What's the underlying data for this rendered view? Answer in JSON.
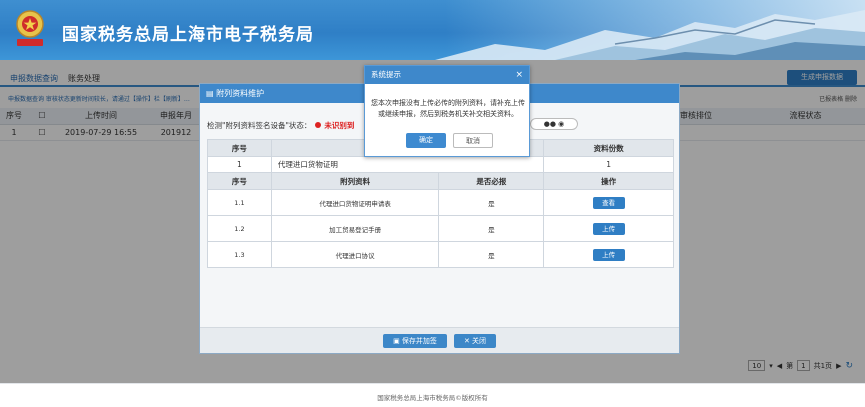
{
  "header": {
    "title": "国家税务总局上海市电子税务局",
    "emblem_text": "中国税务"
  },
  "tabs": [
    {
      "label": "申报数据查询",
      "active": true
    },
    {
      "label": "账务处理",
      "active": false
    }
  ],
  "toolbar": {
    "generate_label": "生成申报数据",
    "notice": "申报数据查询 审核状态更新时间较长，请通过【操作】栏【刷新】…",
    "right_links": "已报表格   删除"
  },
  "main_table": {
    "headers": [
      "序号",
      "",
      "上传时间",
      "申报年月",
      "",
      "",
      "",
      "",
      "",
      "审核排位",
      "流程状态"
    ],
    "rows": [
      [
        "1",
        "",
        "2019-07-29 16:55",
        "201912",
        "",
        "",
        "",
        "",
        "",
        "",
        ""
      ]
    ]
  },
  "pager": {
    "page_size": "10",
    "prefix": "第",
    "page": "1",
    "suffix": "共1页"
  },
  "footer": "国家税务总局上海市税务局©版权所有",
  "dialog": {
    "title": "附列资料维护",
    "detect_label": "检测\"附列资料签名设备\"状态：",
    "detect_status": "未识别到",
    "pwd_icon": "●●",
    "cert_table": {
      "headers": [
        "序号",
        "",
        "资料份数"
      ],
      "rows": [
        [
          "1",
          "代理进口货物证明",
          "1"
        ]
      ]
    },
    "att_table": {
      "headers": [
        "序号",
        "附列资料",
        "是否必报",
        "操作"
      ],
      "rows": [
        [
          "1.1",
          "代理进口货物证明申请表",
          "是",
          "查看"
        ],
        [
          "1.2",
          "加工贸易登记手册",
          "是",
          "上传"
        ],
        [
          "1.3",
          "代理进口协议",
          "是",
          "上传"
        ]
      ]
    },
    "save_label": "保存并加签",
    "close_label": "关闭"
  },
  "prompt": {
    "title": "系统提示",
    "message": "您本次申报没有上传必传的附列资料，请补充上传或继续申报，然后到税务机关补交相关资料。",
    "ok_label": "确定",
    "cancel_label": "取消"
  },
  "colors": {
    "primary": "#3e88cb",
    "danger": "#dd2222"
  }
}
